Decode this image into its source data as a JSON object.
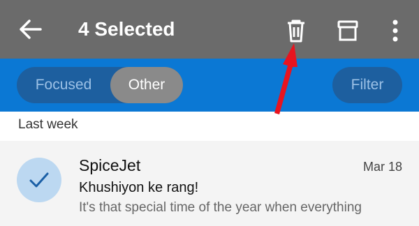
{
  "header": {
    "title": "4 Selected",
    "icons": {
      "back": "back-arrow-icon",
      "delete": "trash-icon",
      "archive": "archive-icon",
      "more": "more-vertical-icon"
    },
    "background": "#6b6b6b"
  },
  "tabs": {
    "items": [
      {
        "label": "Focused",
        "selected": false
      },
      {
        "label": "Other",
        "selected": true
      }
    ],
    "filter_label": "Filter",
    "background": "#0b78d4"
  },
  "section": {
    "label": "Last week"
  },
  "messages": [
    {
      "sender": "SpiceJet",
      "date": "Mar 18",
      "subject": "Khushiyon ke rang!",
      "preview": "It's that special time of the year when everything",
      "selected": true
    }
  ],
  "annotation": {
    "color": "#e8141f"
  }
}
